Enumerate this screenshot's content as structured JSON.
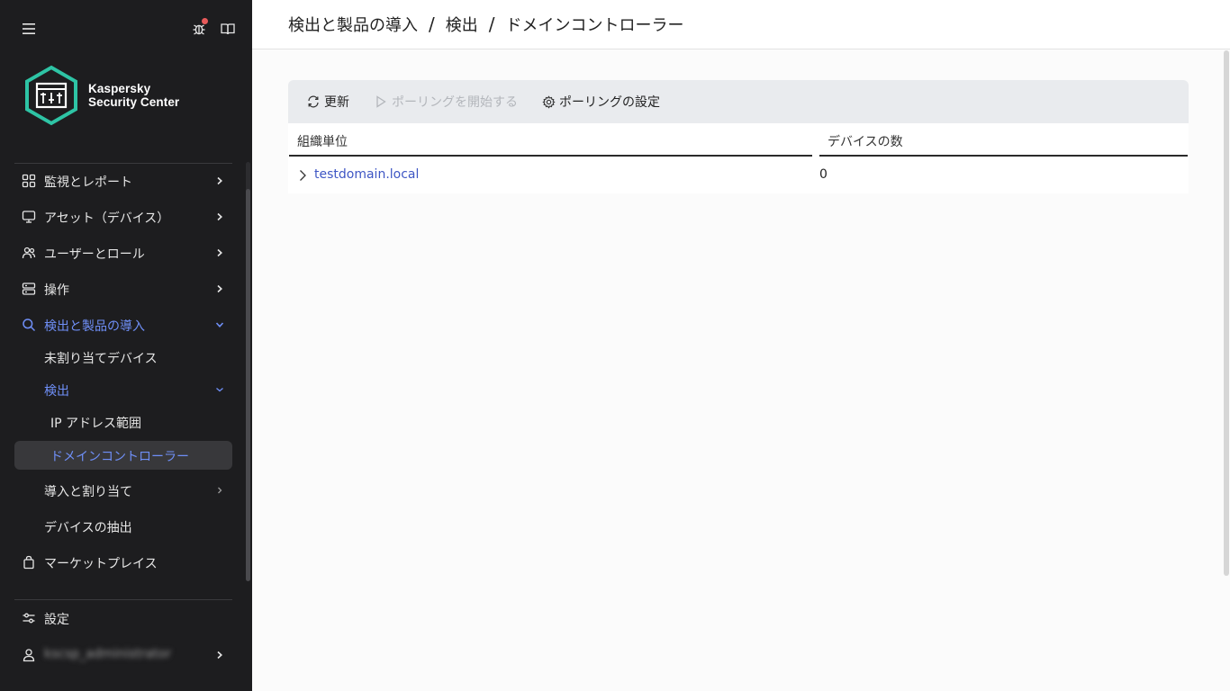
{
  "app": {
    "brand_line1": "Kaspersky",
    "brand_line2": "Security Center"
  },
  "sidebar": {
    "items": [
      {
        "label": "監視とレポート",
        "icon": "dashboard-icon"
      },
      {
        "label": "アセット（デバイス）",
        "icon": "monitor-icon"
      },
      {
        "label": "ユーザーとロール",
        "icon": "users-icon"
      },
      {
        "label": "操作",
        "icon": "server-icon"
      },
      {
        "label": "検出と製品の導入",
        "icon": "search-icon"
      },
      {
        "label": "未割り当てデバイス"
      },
      {
        "label": "検出"
      },
      {
        "label": "IP アドレス範囲"
      },
      {
        "label": "ドメインコントローラー"
      },
      {
        "label": "導入と割り当て"
      },
      {
        "label": "デバイスの抽出"
      },
      {
        "label": "マーケットプレイス",
        "icon": "bag-icon"
      }
    ],
    "settings_label": "設定",
    "user_name": "kscsp_administrator"
  },
  "breadcrumb": {
    "items": [
      "検出と製品の導入",
      "検出",
      "ドメインコントローラー"
    ],
    "separator": "/"
  },
  "toolbar": {
    "refresh_label": "更新",
    "start_polling_label": "ポーリングを開始する",
    "polling_settings_label": "ポーリングの設定"
  },
  "table": {
    "columns": [
      "組織単位",
      "デバイスの数"
    ],
    "rows": [
      {
        "name": "testdomain.local",
        "count": "0"
      }
    ]
  },
  "colors": {
    "sidebar_bg": "#1d1d1f",
    "accent": "#6f8ff7",
    "link": "#3e56c4",
    "logo_hex": "#2ec4a5",
    "notification": "#e85a5a"
  }
}
